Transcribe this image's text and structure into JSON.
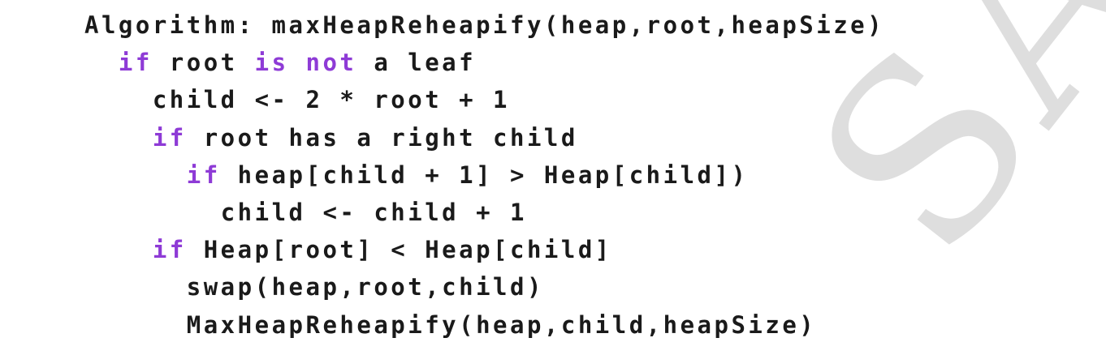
{
  "watermark": {
    "text": "SAMPLE",
    "color": "#dedede"
  },
  "colors": {
    "text": "#1a1a1a",
    "keyword": "#8e3bd6",
    "background": "#ffffff"
  },
  "algorithm": {
    "lines": [
      {
        "indent": 0,
        "segments": [
          {
            "text": "Algorithm: maxHeapReheapify(heap,root,heapSize)"
          }
        ]
      },
      {
        "indent": 1,
        "segments": [
          {
            "text": "if",
            "keyword": true
          },
          {
            "text": " root "
          },
          {
            "text": "is not",
            "keyword": true
          },
          {
            "text": " a leaf"
          }
        ]
      },
      {
        "indent": 2,
        "segments": [
          {
            "text": "child <- 2 * root + 1"
          }
        ]
      },
      {
        "indent": 2,
        "segments": [
          {
            "text": "if",
            "keyword": true
          },
          {
            "text": " root has a right child"
          }
        ]
      },
      {
        "indent": 3,
        "segments": [
          {
            "text": "if",
            "keyword": true
          },
          {
            "text": " heap[child + 1] > Heap[child])"
          }
        ]
      },
      {
        "indent": 4,
        "segments": [
          {
            "text": "child <- child + 1"
          }
        ]
      },
      {
        "indent": 2,
        "segments": [
          {
            "text": "if",
            "keyword": true
          },
          {
            "text": " Heap[root] < Heap[child]"
          }
        ]
      },
      {
        "indent": 3,
        "segments": [
          {
            "text": "swap(heap,root,child)"
          }
        ]
      },
      {
        "indent": 3,
        "segments": [
          {
            "text": "MaxHeapReheapify(heap,child,heapSize)"
          }
        ]
      }
    ]
  }
}
